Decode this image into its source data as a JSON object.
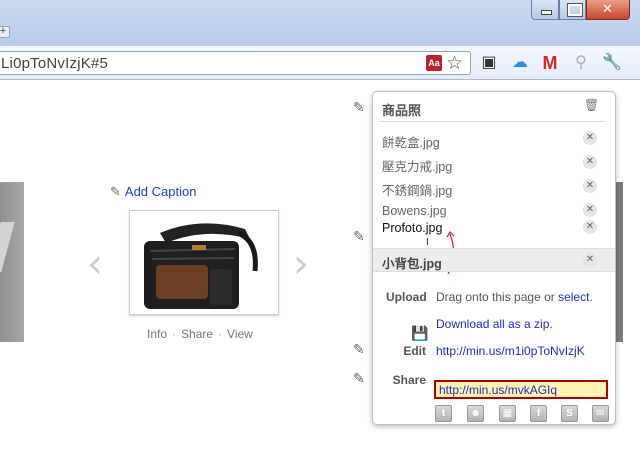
{
  "browser": {
    "new_tab": "+",
    "url": "Li0pToNvIzjK#5",
    "ext_badge": "Aa"
  },
  "gallery": {
    "add_caption": "Add Caption",
    "actions": [
      "Info",
      "Share",
      "View"
    ]
  },
  "panel": {
    "title": "商品照",
    "files": [
      "餅乾盒.jpg",
      "壓克力戒.jpg",
      "不銹鋼鍋.jpg",
      "Bowens.jpg",
      "Profoto.jpg",
      "小背包.jpg"
    ],
    "upload_label": "Upload",
    "upload_text": "Drag onto this page or",
    "upload_link": "select",
    "upload_period": ".",
    "download_text": "Download all as a zip.",
    "edit_label": "Edit",
    "edit_url": "http://min.us/m1i0pToNvIzjK",
    "share_label": "Share",
    "share_url": "http://min.us/mvkAGIq",
    "social_icons": [
      "twitter-icon",
      "myspace-icon",
      "delicious-icon",
      "facebook-icon",
      "stumbleupon-icon",
      "email-icon"
    ]
  },
  "colors": {
    "link": "#1a2ec8",
    "share_highlight": "#fff3b3",
    "share_border": "#b00000"
  }
}
